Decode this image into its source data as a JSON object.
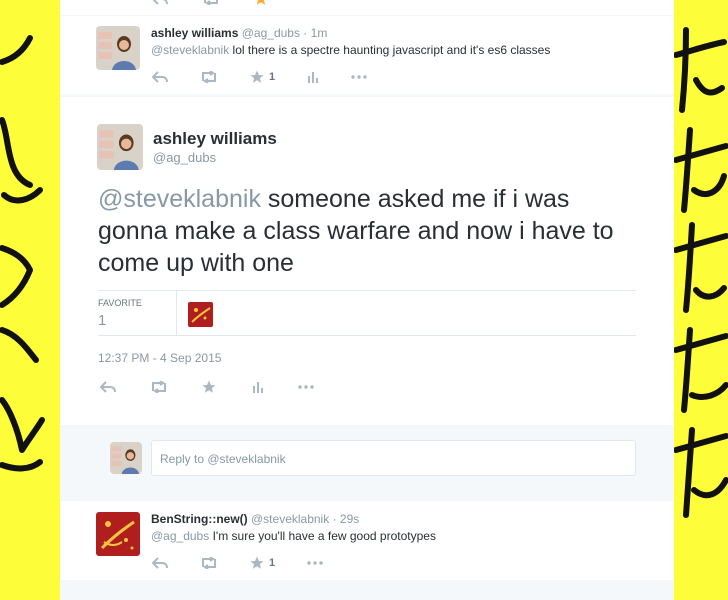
{
  "tweet1": {
    "name": "ashley williams",
    "handle": "@ag_dubs",
    "sep": " · ",
    "time": "1m",
    "mention": "@steveklabnik",
    "text": " lol there is a spectre haunting javascript and it's es6 classes",
    "like_count": "1"
  },
  "main": {
    "name": "ashley williams",
    "handle": "@ag_dubs",
    "mention": "@steveklabnik",
    "text": " someone asked me if i was gonna make a class warfare and now i have to come up with one",
    "favorite_label": "FAVORITE",
    "favorite_count": "1",
    "timestamp": "12:37 PM - 4 Sep 2015"
  },
  "reply": {
    "prefix": "Reply to ",
    "mention": "@steveklabnik"
  },
  "tweet2": {
    "name": "BenString::new()",
    "handle": "@steveklabnik",
    "sep": " · ",
    "time": "29s",
    "mention": "@ag_dubs",
    "text": " I'm sure you'll have a few good prototypes",
    "like_count": "1"
  },
  "colors": {
    "background": "#fdfd3a",
    "stream": "#f5f8fa",
    "star_active": "#ffac33",
    "muted": "#8899a6"
  }
}
